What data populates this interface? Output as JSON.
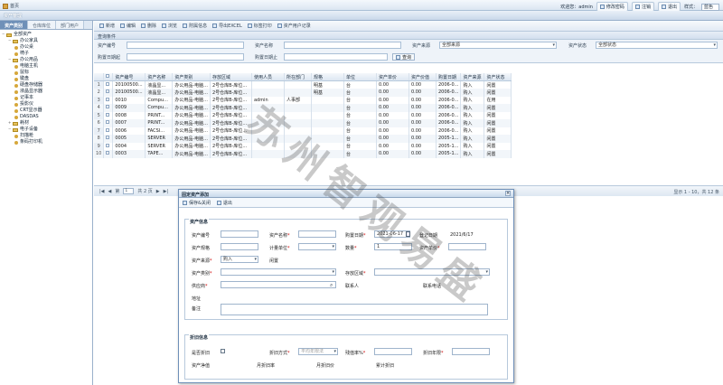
{
  "topbar": {
    "home": "首页",
    "welcome": "欢迎您：admin",
    "change_pwd": "修改密码",
    "logout": "注销",
    "exit": "退出",
    "skin_label": "样式：",
    "skin_value": "蓝色"
  },
  "app": {
    "title": "资产管理"
  },
  "left": {
    "tabs": [
      "资产类别",
      "仓库库位",
      "部门用户"
    ],
    "tree": [
      {
        "label": "全部资产",
        "depth": 0,
        "type": "folder",
        "ctl": "−"
      },
      {
        "label": "办公家具",
        "depth": 1,
        "type": "folder",
        "ctl": "−"
      },
      {
        "label": "办公桌",
        "depth": 2,
        "type": "leaf"
      },
      {
        "label": "椅子",
        "depth": 2,
        "type": "leaf"
      },
      {
        "label": "办公用品",
        "depth": 1,
        "type": "folder",
        "ctl": "−"
      },
      {
        "label": "电脑主机",
        "depth": 2,
        "type": "leaf"
      },
      {
        "label": "鼠标",
        "depth": 2,
        "type": "leaf"
      },
      {
        "label": "键盘",
        "depth": 2,
        "type": "leaf"
      },
      {
        "label": "硬盘存储器",
        "depth": 2,
        "type": "leaf"
      },
      {
        "label": "液晶显示器",
        "depth": 2,
        "type": "leaf"
      },
      {
        "label": "记事本",
        "depth": 2,
        "type": "leaf"
      },
      {
        "label": "投影仪",
        "depth": 2,
        "type": "leaf"
      },
      {
        "label": "CRT显示器",
        "depth": 2,
        "type": "leaf"
      },
      {
        "label": "DASDAS",
        "depth": 2,
        "type": "leaf"
      },
      {
        "label": "耗材",
        "depth": 1,
        "type": "folder",
        "ctl": "+"
      },
      {
        "label": "电子设备",
        "depth": 1,
        "type": "folder",
        "ctl": "−"
      },
      {
        "label": "扫描枪",
        "depth": 2,
        "type": "leaf"
      },
      {
        "label": "条码打印机",
        "depth": 2,
        "type": "leaf"
      }
    ]
  },
  "toolbar": {
    "items": [
      "新增",
      "编辑",
      "删除",
      "浏览",
      "附属信息",
      "导出EXCEL",
      "标签打印",
      "资产用户记录"
    ]
  },
  "query": {
    "title": "查询条件",
    "code_label": "资产编号",
    "name_label": "资产名称",
    "source_label": "资产来源",
    "source_value": "全部来源",
    "status_label": "资产状态",
    "status_value": "全部状态",
    "date_from_label": "购置日期起",
    "date_to_label": "购置日期止",
    "search_btn": "查询"
  },
  "grid": {
    "headers": [
      "资产编号",
      "资产名称",
      "资产类别",
      "存放区域",
      "使用人员",
      "所在部门",
      "规格",
      "单位",
      "资产单价",
      "资产价值",
      "购置日期",
      "资产来源",
      "资产状态"
    ],
    "rows": [
      {
        "n": "1",
        "c": [
          "20100500...",
          "液晶显...",
          "办公用品-电脑...",
          "2号仓库B-库位...",
          "",
          "",
          "明基",
          "台",
          "0.00",
          "0.00",
          "2006-0...",
          "购入",
          "闲置"
        ]
      },
      {
        "n": "2",
        "c": [
          "20100500...",
          "液晶显...",
          "办公用品-电脑...",
          "2号仓库B-库位...",
          "",
          "",
          "明基",
          "台",
          "0.00",
          "0.00",
          "2006-0...",
          "购入",
          "闲置"
        ]
      },
      {
        "n": "3",
        "c": [
          "0010",
          "Compu...",
          "办公用品-电脑...",
          "2号仓库B-库位...",
          "admin",
          "人事部",
          "",
          "台",
          "0.00",
          "0.00",
          "2006-0...",
          "购入",
          "在用"
        ]
      },
      {
        "n": "4",
        "c": [
          "0009",
          "Compu...",
          "办公用品-电脑...",
          "2号仓库B-库位...",
          "",
          "",
          "",
          "台",
          "0.00",
          "0.00",
          "2006-0...",
          "购入",
          "闲置"
        ]
      },
      {
        "n": "5",
        "c": [
          "0008",
          "PRINT...",
          "办公用品-电脑...",
          "2号仓库B-库位...",
          "",
          "",
          "",
          "台",
          "0.00",
          "0.00",
          "2006-0...",
          "购入",
          "闲置"
        ]
      },
      {
        "n": "6",
        "c": [
          "0007",
          "PRINT...",
          "办公用品-电脑...",
          "2号仓库B-库位...",
          "",
          "",
          "",
          "台",
          "0.00",
          "0.00",
          "2006-0...",
          "购入",
          "闲置"
        ]
      },
      {
        "n": "7",
        "c": [
          "0006",
          "FACSI...",
          "办公用品-电脑...",
          "2号仓库B-库位...",
          "",
          "",
          "",
          "台",
          "0.00",
          "0.00",
          "2006-0...",
          "购入",
          "闲置"
        ]
      },
      {
        "n": "8",
        "c": [
          "0005",
          "SERVER",
          "办公用品-电脑...",
          "2号仓库B-库位...",
          "",
          "",
          "",
          "台",
          "0.00",
          "0.00",
          "2005-1...",
          "购入",
          "闲置"
        ]
      },
      {
        "n": "9",
        "c": [
          "0004",
          "SERVER",
          "办公用品-电脑...",
          "2号仓库B-库位...",
          "",
          "",
          "",
          "台",
          "0.00",
          "0.00",
          "2005-1...",
          "购入",
          "闲置"
        ]
      },
      {
        "n": "10",
        "c": [
          "0003",
          "TAPE...",
          "办公用品-电脑...",
          "2号仓库B-库位...",
          "",
          "",
          "",
          "台",
          "0.00",
          "0.00",
          "2005-1...",
          "购入",
          "闲置"
        ]
      }
    ]
  },
  "pager": {
    "page_label": "第",
    "page_value": "1",
    "of_label": "共 2 页",
    "info": "显示 1 - 10，共 12 条"
  },
  "watermark": "苏州智观易盛",
  "dialog": {
    "title": "固定资产添加",
    "save_btn": "保存&关闭",
    "exit_btn": "退出",
    "close": "×",
    "section1": "资产信息",
    "section2": "折旧信息",
    "code": "资产编号",
    "name": "资产名称",
    "buy_date": "购置日期",
    "buy_date_value": "2021-06-17",
    "reg_date": "登记日期",
    "reg_date_value": "2021/6/17",
    "spec": "资产规格",
    "unit": "计量单位",
    "qty": "数量",
    "qty_value": "1",
    "price": "资产单价",
    "source": "资产来源",
    "source_value": "购入",
    "idle": "闲置",
    "category": "资产类别",
    "area": "存放区域",
    "supplier": "供应商",
    "contact": "联系人",
    "phone": "联系电话",
    "address": "地址",
    "remark": "备注",
    "depr_flag": "是否折旧",
    "depr_method": "折旧方式",
    "depr_method_value": "平均年限法",
    "residual": "残值率%",
    "depr_years": "折旧年限",
    "net": "资产净值",
    "month_depr": "月折旧率",
    "month_amt": "月折旧价",
    "total_depr": "累计折旧",
    "req": "*"
  }
}
